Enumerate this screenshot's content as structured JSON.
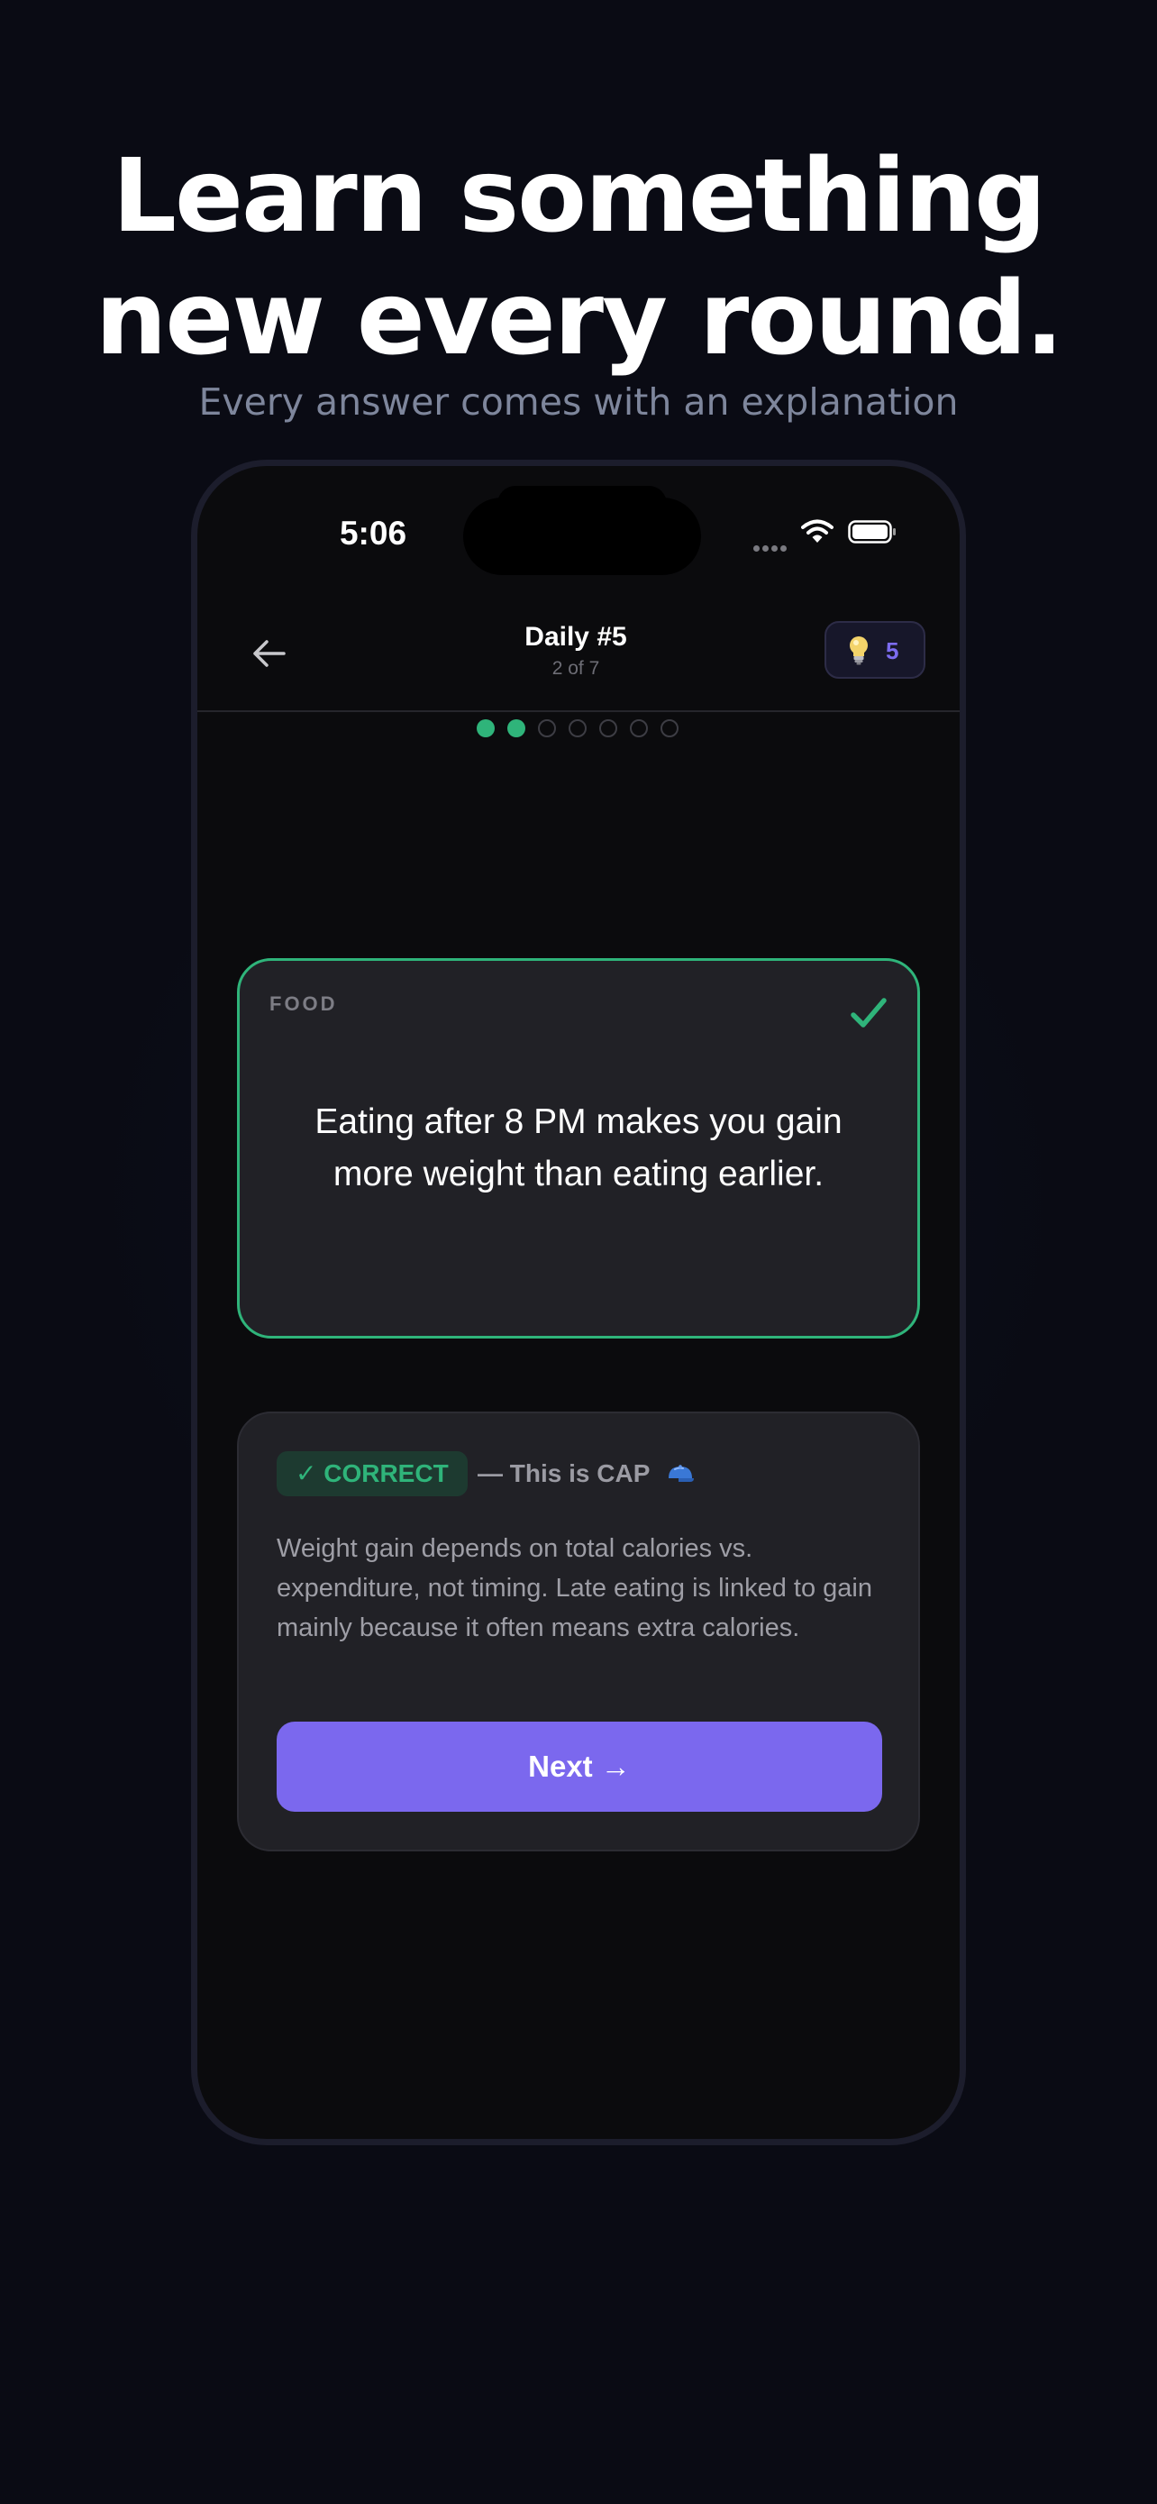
{
  "headline": {
    "line1": "Learn something",
    "line2": "new every round.",
    "subtitle": "Every answer comes with an explanation"
  },
  "status_bar": {
    "time": "5:06",
    "signal_icon": "signal-dots-icon",
    "wifi_icon": "wifi-icon",
    "battery_icon": "battery-icon"
  },
  "nav": {
    "back_icon": "arrow-left-icon",
    "title": "Daily #5",
    "subtitle": "2 of 7",
    "hint_icon": "lightbulb-icon",
    "hints_count": "5"
  },
  "progress": {
    "completed": 2,
    "total": 7
  },
  "card": {
    "category": "FOOD",
    "statement": "Eating after 8 PM makes you gain more weight than eating earlier.",
    "result_icon": "check-icon"
  },
  "result": {
    "badge": "✓ CORRECT",
    "verdict": "— This is CAP",
    "verdict_icon": "cap-icon",
    "explanation": "Weight gain depends on total calories vs. expenditure, not timing. Late eating is linked to gain mainly because it often means extra calories.",
    "next_label": "Next →"
  },
  "colors": {
    "background": "#0a0b14",
    "accent_green": "#2fb47a",
    "accent_purple": "#7b68ee",
    "card_background": "#212126"
  }
}
